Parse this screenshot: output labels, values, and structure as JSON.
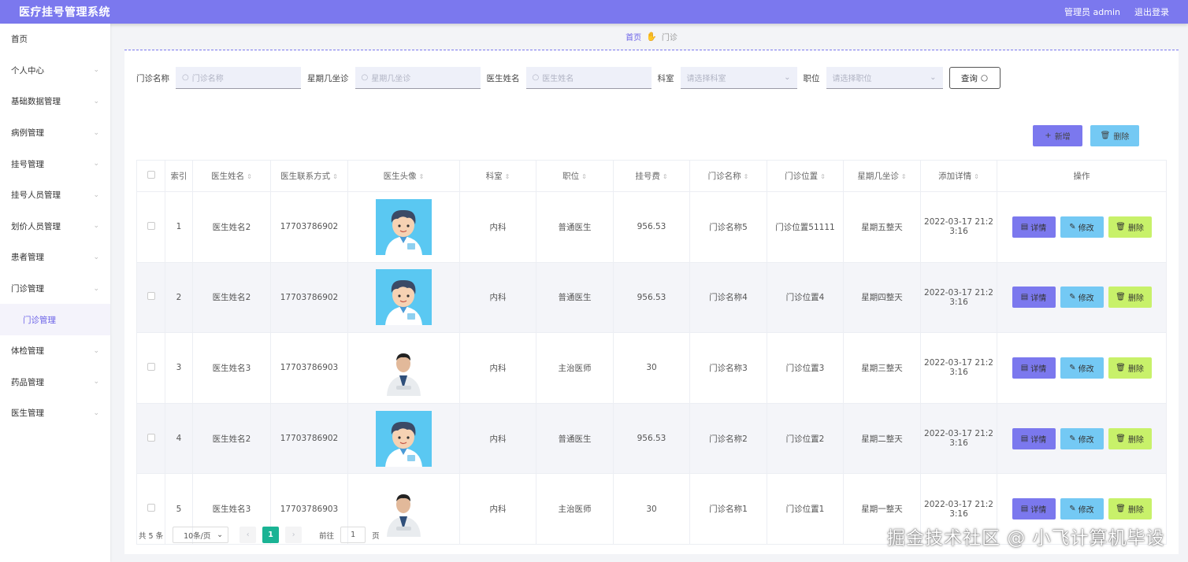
{
  "header": {
    "title": "医疗挂号管理系统",
    "user": "管理员 admin",
    "logout": "退出登录"
  },
  "sidebar": {
    "items": [
      {
        "label": "首页",
        "chevron": false
      },
      {
        "label": "个人中心",
        "chevron": true
      },
      {
        "label": "基础数据管理",
        "chevron": true
      },
      {
        "label": "病例管理",
        "chevron": true
      },
      {
        "label": "挂号管理",
        "chevron": true
      },
      {
        "label": "挂号人员管理",
        "chevron": true
      },
      {
        "label": "划价人员管理",
        "chevron": true
      },
      {
        "label": "患者管理",
        "chevron": true
      },
      {
        "label": "门诊管理",
        "chevron": true
      },
      {
        "label": "门诊管理",
        "sub": true
      },
      {
        "label": "体检管理",
        "chevron": true
      },
      {
        "label": "药品管理",
        "chevron": true
      },
      {
        "label": "医生管理",
        "chevron": true
      }
    ]
  },
  "breadcrumb": {
    "home": "首页",
    "current": "门诊"
  },
  "search": {
    "clinic_label": "门诊名称",
    "clinic_placeholder": "门诊名称",
    "week_label": "星期几坐诊",
    "week_placeholder": "星期几坐诊",
    "doctor_label": "医生姓名",
    "doctor_placeholder": "医生姓名",
    "dept_label": "科室",
    "dept_placeholder": "请选择科室",
    "title_label": "职位",
    "title_placeholder": "请选择职位",
    "query_button": "查询"
  },
  "actions": {
    "add": "新增",
    "delete": "删除"
  },
  "table": {
    "headers": [
      "索引",
      "医生姓名",
      "医生联系方式",
      "医生头像",
      "科室",
      "职位",
      "挂号费",
      "门诊名称",
      "门诊位置",
      "星期几坐诊",
      "添加详情",
      "操作"
    ],
    "rows": [
      {
        "index": "1",
        "name": "医生姓名2",
        "phone": "17703786902",
        "avatar": "cartoon",
        "dept": "内科",
        "title": "普通医生",
        "fee": "956.53",
        "clinic": "门诊名称5",
        "location": "门诊位置51111",
        "week": "星期五整天",
        "time_a": "2022-03-17 21:2",
        "time_b": "3:16"
      },
      {
        "index": "2",
        "name": "医生姓名2",
        "phone": "17703786902",
        "avatar": "cartoon",
        "dept": "内科",
        "title": "普通医生",
        "fee": "956.53",
        "clinic": "门诊名称4",
        "location": "门诊位置4",
        "week": "星期四整天",
        "time_a": "2022-03-17 21:2",
        "time_b": "3:16"
      },
      {
        "index": "3",
        "name": "医生姓名3",
        "phone": "17703786903",
        "avatar": "photo",
        "dept": "内科",
        "title": "主治医师",
        "fee": "30",
        "clinic": "门诊名称3",
        "location": "门诊位置3",
        "week": "星期三整天",
        "time_a": "2022-03-17 21:2",
        "time_b": "3:16"
      },
      {
        "index": "4",
        "name": "医生姓名2",
        "phone": "17703786902",
        "avatar": "cartoon",
        "dept": "内科",
        "title": "普通医生",
        "fee": "956.53",
        "clinic": "门诊名称2",
        "location": "门诊位置2",
        "week": "星期二整天",
        "time_a": "2022-03-17 21:2",
        "time_b": "3:16"
      },
      {
        "index": "5",
        "name": "医生姓名3",
        "phone": "17703786903",
        "avatar": "photo",
        "dept": "内科",
        "title": "主治医师",
        "fee": "30",
        "clinic": "门诊名称1",
        "location": "门诊位置1",
        "week": "星期一整天",
        "time_a": "2022-03-17 21:2",
        "time_b": "3:16"
      }
    ],
    "row_actions": {
      "detail": "详情",
      "edit": "修改",
      "delete": "删除"
    }
  },
  "pagination": {
    "total": "共 5 条",
    "page_size": "10条/页",
    "current_page": "1",
    "goto_label": "前往",
    "goto_value": "1",
    "page_suffix": "页"
  },
  "watermark": "掘金技术社区 @ 小飞计算机毕设",
  "colors": {
    "header": "#7b78ee",
    "accent": "#6c63e8",
    "edit": "#74c9f4",
    "delete": "#c8f16a",
    "page_active": "#1ab394"
  }
}
